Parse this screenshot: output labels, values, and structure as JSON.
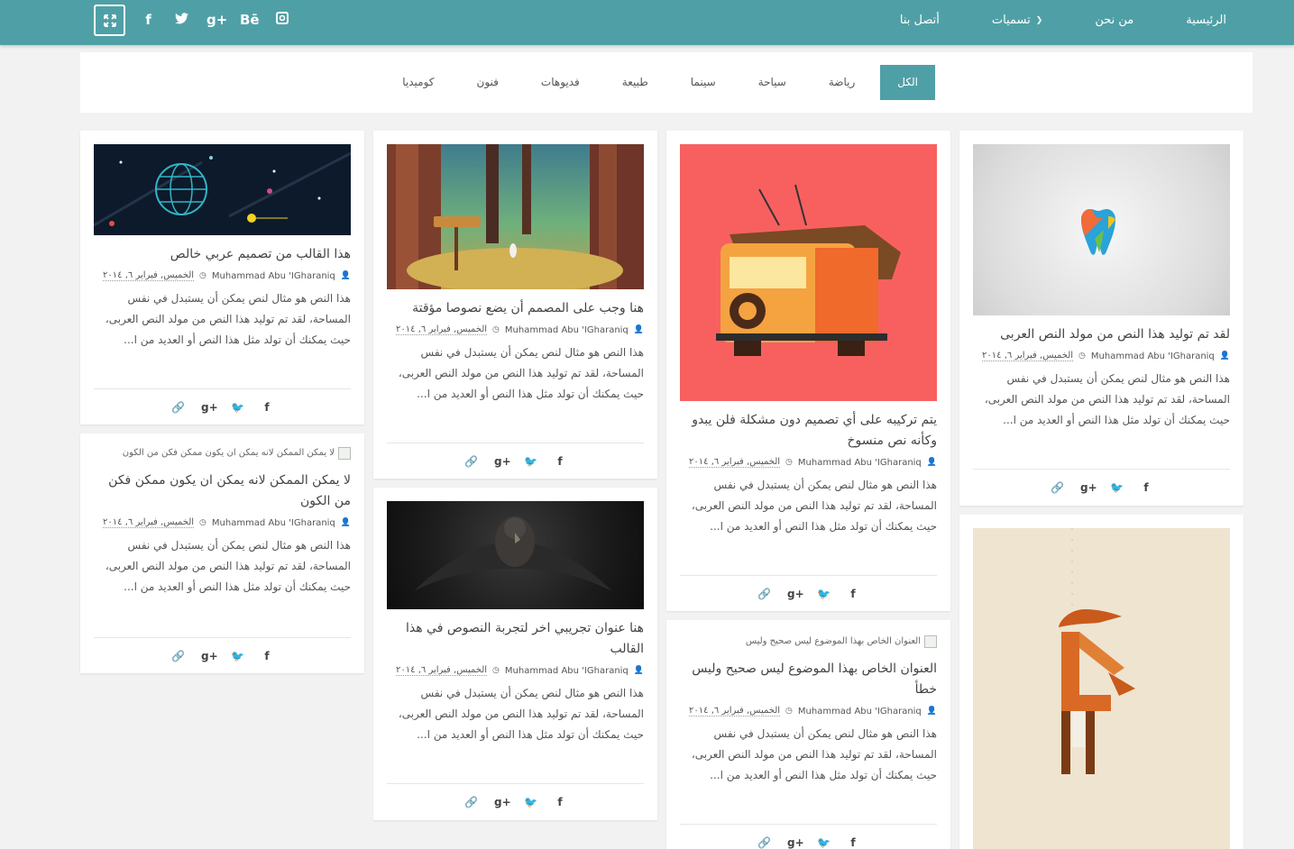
{
  "topbar": {
    "nav": [
      "الرئيسية",
      "من نحن",
      "تسميات",
      "أتصل بنا"
    ],
    "social_icons": [
      "instagram-icon",
      "behance-icon",
      "google-plus-icon",
      "twitter-icon",
      "facebook-icon"
    ],
    "social_glyphs": [
      "◙",
      "Bē",
      "g+",
      "🐦",
      "f"
    ],
    "expand_icon": "expand-icon",
    "colors": {
      "accent": "#4fa0a6"
    }
  },
  "filters": [
    "الكل",
    "رياضة",
    "سياحة",
    "سينما",
    "طبيعة",
    "فديوهات",
    "فنون",
    "كوميديا"
  ],
  "common": {
    "author": "Muhammad Abu 'IGharaniq",
    "date": "الخميس, فبراير ٦, ٢٠١٤",
    "excerpt": "هذا النص هو مثال لنص يمكن أن يستبدل في نفس المساحة، لقد تم توليد هذا النص من مولد النص العربى، حيث يمكنك أن تولد مثل هذا النص أو العديد من ا...",
    "share": {
      "fb": "f",
      "tw": "🐦",
      "gp": "g+",
      "link": "🔗"
    }
  },
  "cards": {
    "c1": {
      "title": "لقد تم توليد هذا النص من مولد النص العربى"
    },
    "c2": {
      "title": ""
    },
    "c3": {
      "title": "يتم تركيبه على أي تصميم دون مشكلة فلن يبدو وكأنه نص منسوخ"
    },
    "c4": {
      "title": "العنوان الخاص بهذا الموضوع ليس صحيح وليس خطأ",
      "broken_alt": "العنوان الخاص بهذا الموضوع ليس صحيح وليس"
    },
    "c5": {
      "title": "هنا وجب على المصمم أن يضع نصوصا مؤقتة"
    },
    "c6": {
      "title": "هنا عنوان تجريبي اخر لتجربة النصوص في هذا القالب"
    },
    "c7": {
      "title": "هذا القالب من تصميم عربي خالص"
    },
    "c8": {
      "title": "لا يمكن الممكن لانه يمكن ان يكون ممكن فكن من الكون",
      "broken_alt": "لا يمكن الممكن لانه يمكن ان يكون ممكن فكن من الكون"
    }
  }
}
